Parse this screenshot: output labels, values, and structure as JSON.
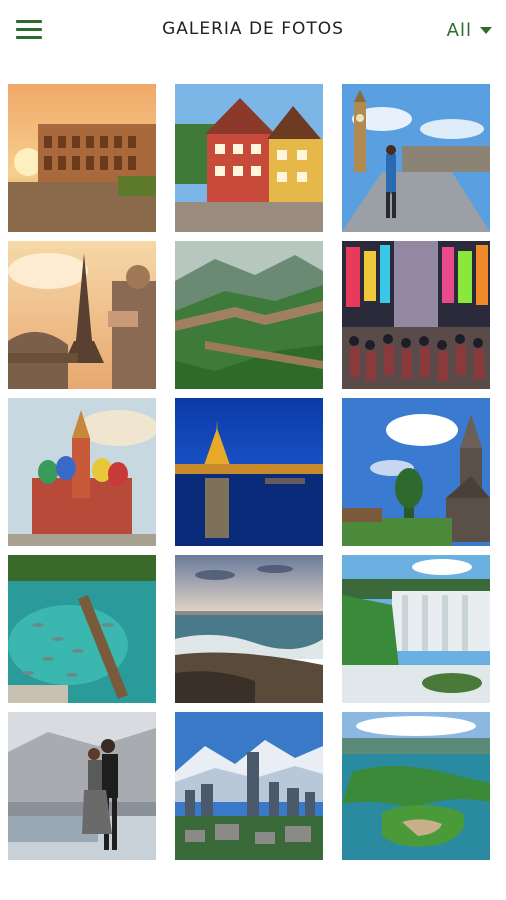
{
  "header": {
    "title": "GALERIA DE FOTOS",
    "filter_label": "All"
  },
  "icons": {
    "menu": "hamburger-menu-icon",
    "dropdown": "caret-down-icon"
  },
  "colors": {
    "accent": "#2e6b2e"
  },
  "photos": [
    {
      "subject": "colosseum-sunset"
    },
    {
      "subject": "half-timbered-houses"
    },
    {
      "subject": "big-ben-street"
    },
    {
      "subject": "eiffel-tower-selfie"
    },
    {
      "subject": "great-wall"
    },
    {
      "subject": "neon-street-crowd"
    },
    {
      "subject": "saint-basils-cathedral"
    },
    {
      "subject": "thai-temple-night"
    },
    {
      "subject": "wooden-church-sky"
    },
    {
      "subject": "clear-lake-fish"
    },
    {
      "subject": "beach-waves"
    },
    {
      "subject": "waterfalls"
    },
    {
      "subject": "tango-dancers"
    },
    {
      "subject": "city-mountains"
    },
    {
      "subject": "lake-islands"
    }
  ]
}
